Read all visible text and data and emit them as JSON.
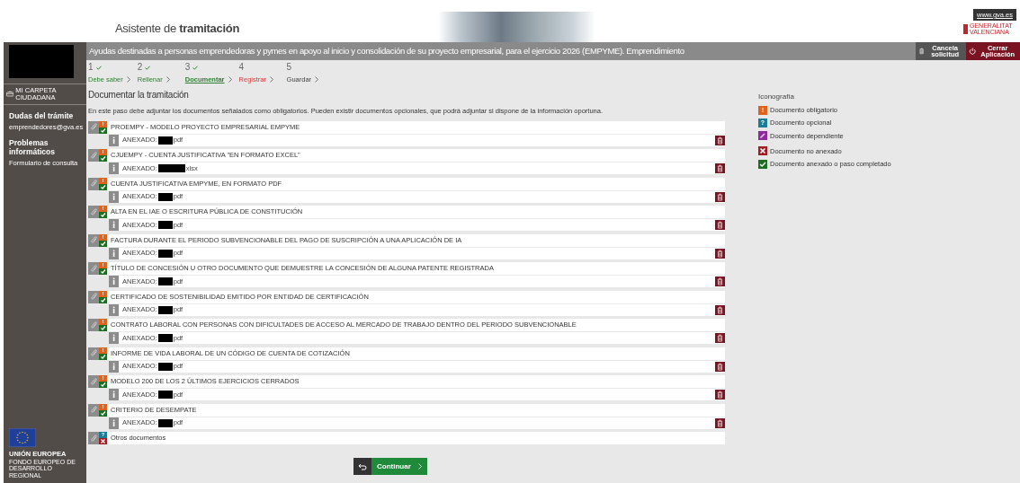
{
  "header": {
    "title": "Asistente de **tramitación**",
    "site_link": "www.gva.es",
    "logo_text": "GENERALITAT VALENCIANA"
  },
  "sidebar": {
    "folder_link": "MI CARPETA CIUDADANA",
    "sections": [
      {
        "heading": "Dudas del trámite",
        "link": "emprendedores@gva.es"
      },
      {
        "heading": "Problemas informáticos",
        "link": "Formulario de consulta"
      }
    ],
    "eu_logo": {
      "title": "UNIÓN EUROPEA",
      "subtitle": "FONDO EUROPEO DE DESARROLLO REGIONAL"
    }
  },
  "title_bar": {
    "title": "Ayudas destinadas a personas emprendedoras y pymes en apoyo al inicio y consolidación de su proyecto empresarial, para el ejercicio 2026 (EMPYME). Emprendimiento",
    "actions": [
      {
        "kind": "cancel",
        "label": "Cancela solicitud"
      },
      {
        "kind": "close",
        "label": "Cerrar Aplicación"
      }
    ]
  },
  "steps": [
    {
      "number": "1",
      "label": "Debe saber",
      "kind": "done",
      "completed": true,
      "selected": false
    },
    {
      "number": "2",
      "label": "Rellenar",
      "kind": "done",
      "completed": true,
      "selected": false
    },
    {
      "number": "3",
      "label": "Documentar",
      "kind": "done",
      "completed": true,
      "selected": true
    },
    {
      "number": "4",
      "label": "Registrar",
      "kind": "next",
      "completed": false,
      "selected": false
    },
    {
      "number": "5",
      "label": "Guardar",
      "kind": "pending",
      "completed": false,
      "selected": false
    }
  ],
  "section": {
    "heading": "Documentar la tramitación",
    "description": "En este paso debe adjuntar los documentos señalados como obligatorios. Pueden existir documentos opcionales, que podrá adjuntar si dispone de la información oportuna."
  },
  "documents": [
    {
      "title": "PROEMPY - MODELO PROYECTO EMPRESARIAL EMPYME",
      "kind": "required",
      "badge": "!",
      "attached": true,
      "attachment": {
        "label": "ANEXADO:",
        "extension": "pdf"
      }
    },
    {
      "title": "CJUEMPY - CUENTA JUSTIFICATIVA \"EN FORMATO EXCEL\"",
      "kind": "required",
      "badge": "!",
      "attached": true,
      "attachment": {
        "label": "ANEXADO:",
        "extension": "xlsx"
      }
    },
    {
      "title": "CUENTA JUSTIFICATIVA EMPYME, EN FORMATO PDF",
      "kind": "required",
      "badge": "!",
      "attached": true,
      "attachment": {
        "label": "ANEXADO:",
        "extension": "pdf"
      }
    },
    {
      "title": "ALTA EN EL IAE O ESCRITURA PÚBLICA DE CONSTITUCIÓN",
      "kind": "required",
      "badge": "!",
      "attached": true,
      "attachment": {
        "label": "ANEXADO:",
        "extension": "pdf"
      }
    },
    {
      "title": "FACTURA DURANTE EL PERIODO SUBVENCIONABLE DEL PAGO DE SUSCRIPCIÓN A UNA APLICACIÓN DE IA",
      "kind": "required",
      "badge": "!",
      "attached": true,
      "attachment": {
        "label": "ANEXADO:",
        "extension": "pdf"
      }
    },
    {
      "title": "TÍTULO DE CONCESIÓN U OTRO DOCUMENTO QUE DEMUESTRE LA CONCESIÓN DE ALGUNA PATENTE REGISTRADA",
      "kind": "required",
      "badge": "!",
      "attached": true,
      "attachment": {
        "label": "ANEXADO:",
        "extension": "pdf"
      }
    },
    {
      "title": "CERTIFICADO DE SOSTENIBILIDAD EMITIDO POR ENTIDAD DE CERTIFICACIÓN",
      "kind": "required",
      "badge": "!",
      "attached": true,
      "attachment": {
        "label": "ANEXADO:",
        "extension": "pdf"
      }
    },
    {
      "title": "CONTRATO LABORAL CON PERSONAS CON DIFICULTADES DE ACCESO AL MERCADO DE TRABAJO DENTRO DEL PERIODO SUBVENCIONABLE",
      "kind": "required",
      "badge": "!",
      "attached": true,
      "attachment": {
        "label": "ANEXADO:",
        "extension": "pdf"
      }
    },
    {
      "title": "INFORME DE VIDA LABORAL DE UN CÓDIGO DE CUENTA DE COTIZACIÓN",
      "kind": "required",
      "badge": "!",
      "attached": true,
      "attachment": {
        "label": "ANEXADO:",
        "extension": "pdf"
      }
    },
    {
      "title": "MODELO 200 DE LOS 2 ÚLTIMOS EJERCICIOS CERRADOS",
      "kind": "required",
      "badge": "!",
      "attached": true,
      "attachment": {
        "label": "ANEXADO:",
        "extension": "pdf"
      }
    },
    {
      "title": "CRITERIO DE DESEMPATE",
      "kind": "required",
      "badge": "!",
      "attached": true,
      "attachment": {
        "label": "ANEXADO:",
        "extension": "pdf"
      }
    },
    {
      "title": "Otros documentos",
      "kind": "optional",
      "badge": "?",
      "attached": false
    }
  ],
  "legend": {
    "title": "Iconografía",
    "items": [
      {
        "kind": "required",
        "symbol": "!",
        "label": "Documento obligatorio"
      },
      {
        "kind": "optional",
        "symbol": "?",
        "label": "Documento opcional"
      },
      {
        "kind": "dependent",
        "label": "Documento dependiente"
      },
      {
        "kind": "missing",
        "label": "Documento no anexado"
      },
      {
        "kind": "attached",
        "label": "Documento anexado o paso completado"
      }
    ]
  },
  "continue_button": {
    "label": "Continuar"
  }
}
